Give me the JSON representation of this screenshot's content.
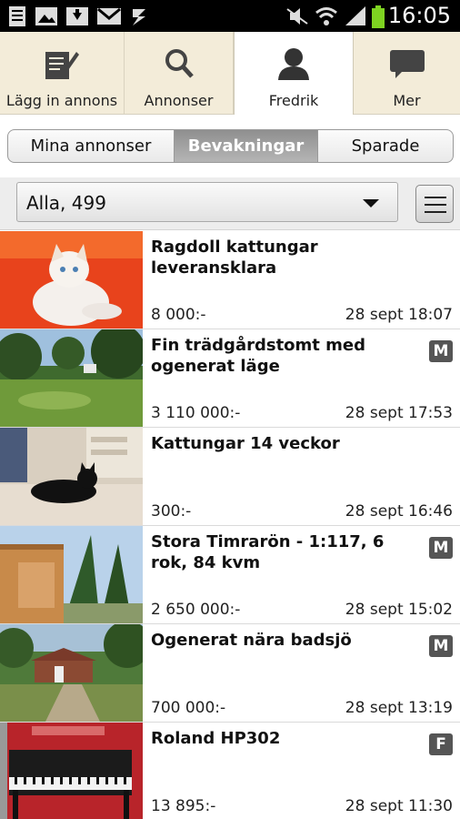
{
  "status_bar": {
    "time": "16:05"
  },
  "tabs": [
    {
      "label": "Lägg in annons",
      "icon": "post-ad-icon"
    },
    {
      "label": "Annonser",
      "icon": "search-icon"
    },
    {
      "label": "Fredrik",
      "icon": "user-icon"
    },
    {
      "label": "Mer",
      "icon": "chat-bubble-icon"
    }
  ],
  "segments": [
    {
      "label": "Mina annonser",
      "selected": false
    },
    {
      "label": "Bevakningar",
      "selected": true
    },
    {
      "label": "Sparade",
      "selected": false
    }
  ],
  "filter": {
    "value": "Alla, 499"
  },
  "listings": [
    {
      "title": "Ragdoll kattungar leveransklara",
      "price": "8 000:-",
      "date": "28 sept 18:07",
      "badge": ""
    },
    {
      "title": "Fin trädgårdstomt med ogenerat läge",
      "price": "3 110 000:-",
      "date": "28 sept 17:53",
      "badge": "M"
    },
    {
      "title": "Kattungar 14 veckor",
      "price": "300:-",
      "date": "28 sept 16:46",
      "badge": ""
    },
    {
      "title": "Stora Timrarön - 1:117, 6 rok, 84 kvm",
      "price": "2 650 000:-",
      "date": "28 sept 15:02",
      "badge": "M"
    },
    {
      "title": "Ogenerat nära badsjö",
      "price": "700 000:-",
      "date": "28 sept 13:19",
      "badge": "M"
    },
    {
      "title": "Roland HP302",
      "price": "13 895:-",
      "date": "28 sept 11:30",
      "badge": "F"
    }
  ]
}
